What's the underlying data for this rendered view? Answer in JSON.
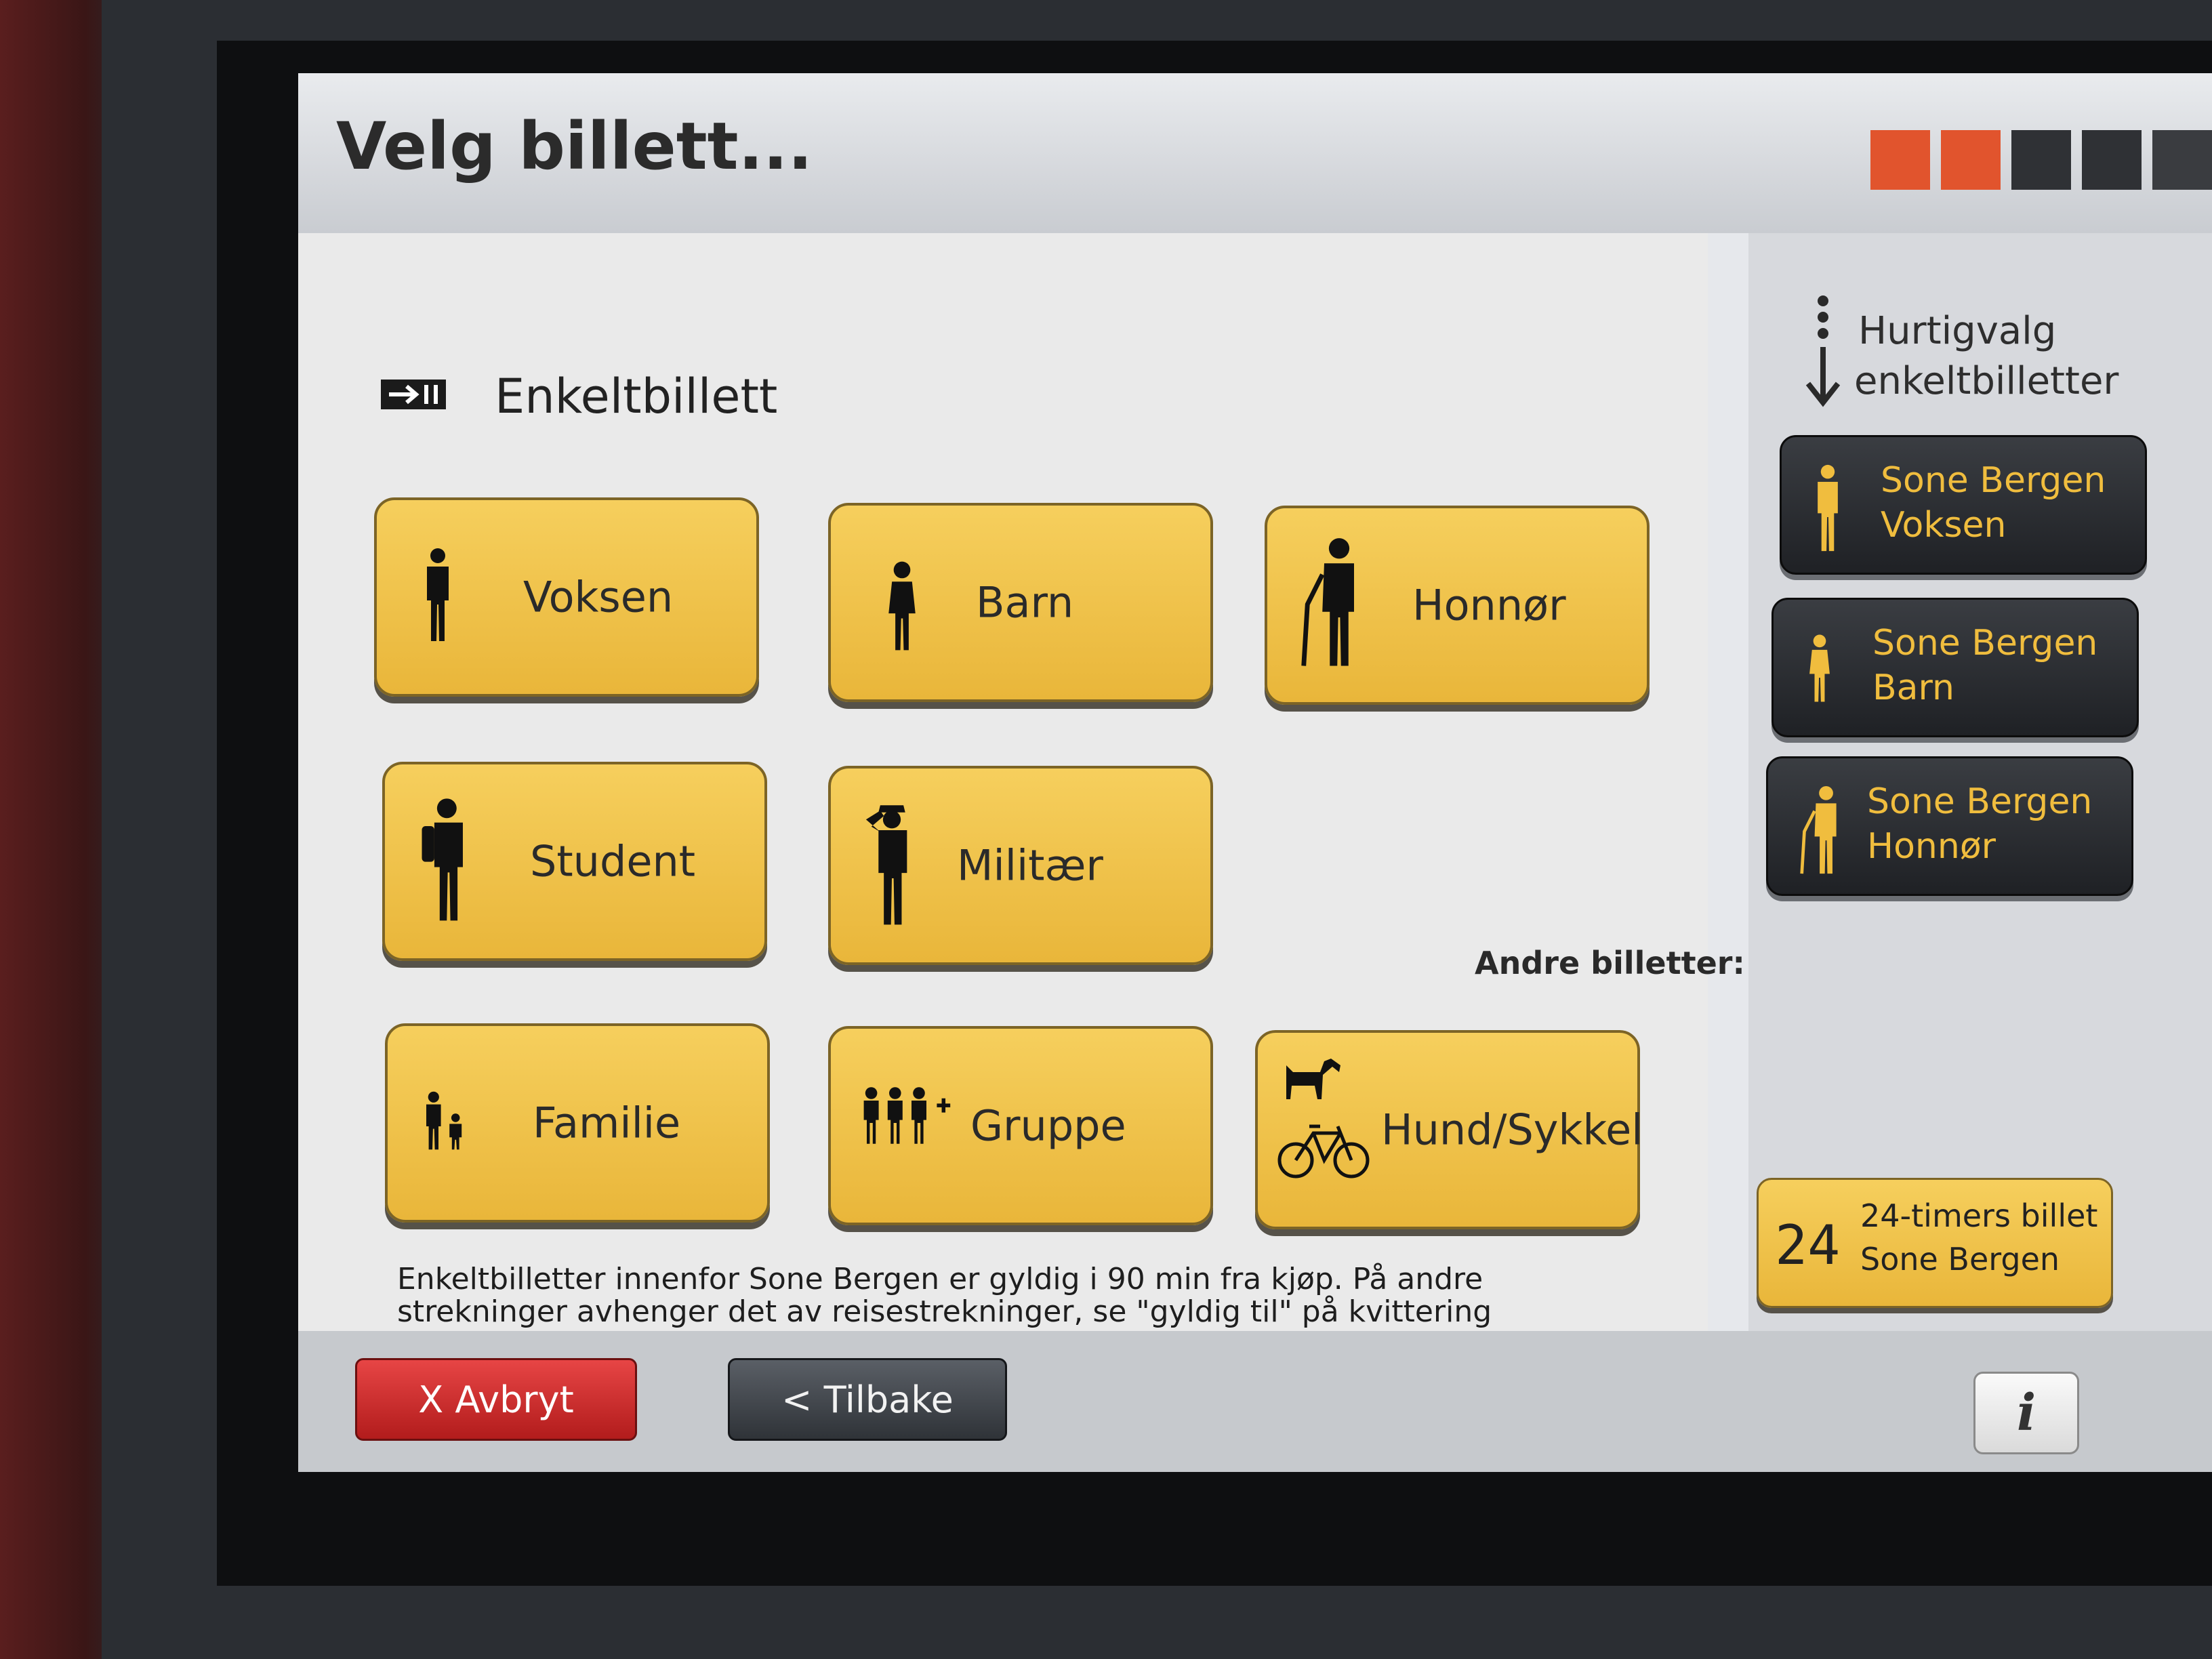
{
  "header": {
    "title": "Velg billett...",
    "steps": [
      {
        "state": "done",
        "color": "#e1542d"
      },
      {
        "state": "done",
        "color": "#e1542d"
      },
      {
        "state": "pending",
        "color": "#2f3135"
      },
      {
        "state": "pending",
        "color": "#2f3135"
      },
      {
        "state": "pending",
        "color": "#3a3c40"
      }
    ]
  },
  "section": {
    "icon": "ticket-arrow-icon",
    "title": "Enkeltbillett"
  },
  "tickets": [
    {
      "label": "Voksen",
      "icon": "adult-icon"
    },
    {
      "label": "Barn",
      "icon": "child-icon"
    },
    {
      "label": "Honnør",
      "icon": "senior-cane-icon"
    },
    {
      "label": "Student",
      "icon": "student-backpack-icon"
    },
    {
      "label": "Militær",
      "icon": "military-salute-icon"
    },
    {
      "label": "Familie",
      "icon": "family-icon"
    },
    {
      "label": "Gruppe",
      "icon": "group-plus-icon"
    },
    {
      "label": "Hund/Sykkel",
      "icon": "dog-bicycle-icon"
    }
  ],
  "description": "Enkeltbilletter innenfor Sone Bergen er gyldig i 90 min fra kjøp. På andre strekninger avhenger det av reisestrekninger, se \"gyldig til\" på kvittering eller kortleser.",
  "quick": {
    "heading_line1": "Hurtigvalg",
    "heading_line2": "enkeltbilletter",
    "items": [
      {
        "line1": "Sone Bergen",
        "line2": "Voksen",
        "icon": "adult-icon"
      },
      {
        "line1": "Sone Bergen",
        "line2": "Barn",
        "icon": "child-icon"
      },
      {
        "line1": "Sone Bergen",
        "line2": "Honnør",
        "icon": "senior-cane-icon"
      }
    ]
  },
  "other": {
    "label": "Andre billetter:",
    "day_ticket": {
      "number": "24",
      "line1": "24-timers billet",
      "line2": "Sone Bergen"
    }
  },
  "footer": {
    "cancel": "X  Avbryt",
    "back": "<  Tilbake",
    "info": "i"
  },
  "colors": {
    "button_yellow": "#f2c44d",
    "dark_button": "#2a2c30",
    "quick_text": "#f0bd3e",
    "cancel_red": "#d63333",
    "progress_active": "#e1542d"
  }
}
